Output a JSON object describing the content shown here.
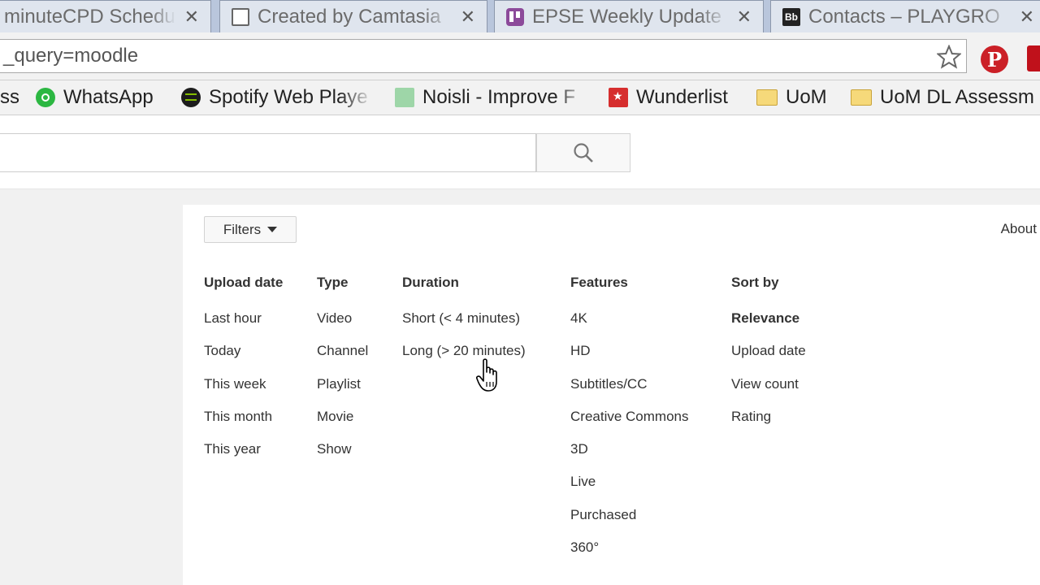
{
  "tabs": [
    {
      "title": "minuteCPD Schedu",
      "favicon": "none",
      "close": "✕"
    },
    {
      "title": "Created by Camtasia",
      "favicon": "document-icon",
      "close": "✕"
    },
    {
      "title": "EPSE Weekly Update",
      "favicon": "trello-icon",
      "close": "✕"
    },
    {
      "title": "Contacts – PLAYGRO",
      "favicon": "blackboard-icon",
      "badge": "Bb",
      "close": "✕"
    }
  ],
  "omnibox": {
    "url": "_query=moodle"
  },
  "bookmarks": [
    {
      "label": "ss",
      "icon": "none"
    },
    {
      "label": "WhatsApp",
      "icon": "whatsapp-icon"
    },
    {
      "label": "Spotify Web Playe",
      "icon": "spotify-icon"
    },
    {
      "label": "Noisli - Improve F",
      "icon": "noisli-icon"
    },
    {
      "label": "Wunderlist",
      "icon": "wunderlist-icon"
    },
    {
      "label": "UoM",
      "icon": "folder-icon"
    },
    {
      "label": "UoM DL Assessm",
      "icon": "folder-icon"
    }
  ],
  "search": {
    "placeholder": ""
  },
  "filters": {
    "button_label": "Filters",
    "about_label": "About",
    "columns": [
      {
        "heading": "Upload date",
        "options": [
          "Last hour",
          "Today",
          "This week",
          "This month",
          "This year"
        ]
      },
      {
        "heading": "Type",
        "options": [
          "Video",
          "Channel",
          "Playlist",
          "Movie",
          "Show"
        ]
      },
      {
        "heading": "Duration",
        "options": [
          "Short (< 4 minutes)",
          "Long (> 20 minutes)"
        ]
      },
      {
        "heading": "Features",
        "options": [
          "4K",
          "HD",
          "Subtitles/CC",
          "Creative Commons",
          "3D",
          "Live",
          "Purchased",
          "360°"
        ]
      },
      {
        "heading": "Sort by",
        "options": [
          "Relevance",
          "Upload date",
          "View count",
          "Rating"
        ],
        "selected": "Relevance"
      }
    ]
  },
  "colors": {
    "pinterest": "#cb2027",
    "tabstrip": "#b9c6dc",
    "text": "#333333"
  }
}
